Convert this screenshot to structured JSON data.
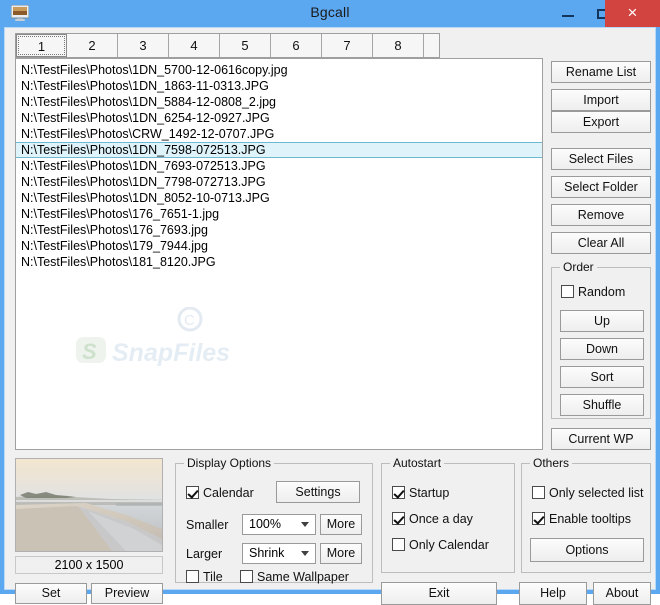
{
  "window": {
    "title": "Bgcall",
    "app_icon": "monitor-icon",
    "titlebar_color": "#5ca8f0",
    "close_button_color": "#d1443f",
    "controls": {
      "minimize": "–",
      "maximize": "□",
      "close": "×"
    }
  },
  "tabs": {
    "items": [
      {
        "label": "1",
        "selected": true
      },
      {
        "label": "2",
        "selected": false
      },
      {
        "label": "3",
        "selected": false
      },
      {
        "label": "4",
        "selected": false
      },
      {
        "label": "5",
        "selected": false
      },
      {
        "label": "6",
        "selected": false
      },
      {
        "label": "7",
        "selected": false
      },
      {
        "label": "8",
        "selected": false
      }
    ]
  },
  "file_list": {
    "selection_color": "#dff3fa",
    "watermark": "SnapFiles",
    "items": [
      {
        "path": "N:\\TestFiles\\Photos\\1DN_5700-12-0616copy.jpg",
        "selected": false
      },
      {
        "path": "N:\\TestFiles\\Photos\\1DN_1863-11-0313.JPG",
        "selected": false
      },
      {
        "path": "N:\\TestFiles\\Photos\\1DN_5884-12-0808_2.jpg",
        "selected": false
      },
      {
        "path": "N:\\TestFiles\\Photos\\1DN_6254-12-0927.JPG",
        "selected": false
      },
      {
        "path": "N:\\TestFiles\\Photos\\CRW_1492-12-0707.JPG",
        "selected": false
      },
      {
        "path": "N:\\TestFiles\\Photos\\1DN_7598-072513.JPG",
        "selected": true
      },
      {
        "path": "N:\\TestFiles\\Photos\\1DN_7693-072513.JPG",
        "selected": false
      },
      {
        "path": "N:\\TestFiles\\Photos\\1DN_7798-072713.JPG",
        "selected": false
      },
      {
        "path": "N:\\TestFiles\\Photos\\1DN_8052-10-0713.JPG",
        "selected": false
      },
      {
        "path": "N:\\TestFiles\\Photos\\176_7651-1.jpg",
        "selected": false
      },
      {
        "path": "N:\\TestFiles\\Photos\\176_7693.jpg",
        "selected": false
      },
      {
        "path": "N:\\TestFiles\\Photos\\179_7944.jpg",
        "selected": false
      },
      {
        "path": "N:\\TestFiles\\Photos\\181_8120.JPG",
        "selected": false
      }
    ]
  },
  "list_actions": {
    "rename_list": "Rename List",
    "import": "Import",
    "export": "Export",
    "select_files": "Select Files",
    "select_folder": "Select Folder",
    "remove": "Remove",
    "clear_all": "Clear All"
  },
  "order": {
    "title": "Order",
    "random_label": "Random",
    "random_checked": false,
    "up": "Up",
    "down": "Down",
    "sort": "Sort",
    "shuffle": "Shuffle",
    "current_wp": "Current WP"
  },
  "preview": {
    "dimensions": "2100 x 1500",
    "set": "Set",
    "preview": "Preview",
    "image_description": "beach-sunset-thumbnail"
  },
  "display_options": {
    "title": "Display Options",
    "calendar_label": "Calendar",
    "calendar_checked": true,
    "settings": "Settings",
    "smaller_label": "Smaller",
    "smaller_value": "100%",
    "larger_label": "Larger",
    "larger_value": "Shrink",
    "more1": "More",
    "more2": "More",
    "tile_label": "Tile",
    "tile_checked": false,
    "same_wallpaper_label": "Same Wallpaper",
    "same_wallpaper_checked": false
  },
  "autostart": {
    "title": "Autostart",
    "startup_label": "Startup",
    "startup_checked": true,
    "once_a_day_label": "Once a day",
    "once_a_day_checked": true,
    "only_calendar_label": "Only Calendar",
    "only_calendar_checked": false
  },
  "others": {
    "title": "Others",
    "only_selected_list_label": "Only selected list",
    "only_selected_list_checked": false,
    "enable_tooltips_label": "Enable tooltips",
    "enable_tooltips_checked": true,
    "options": "Options"
  },
  "footer": {
    "exit": "Exit",
    "help": "Help",
    "about": "About"
  }
}
